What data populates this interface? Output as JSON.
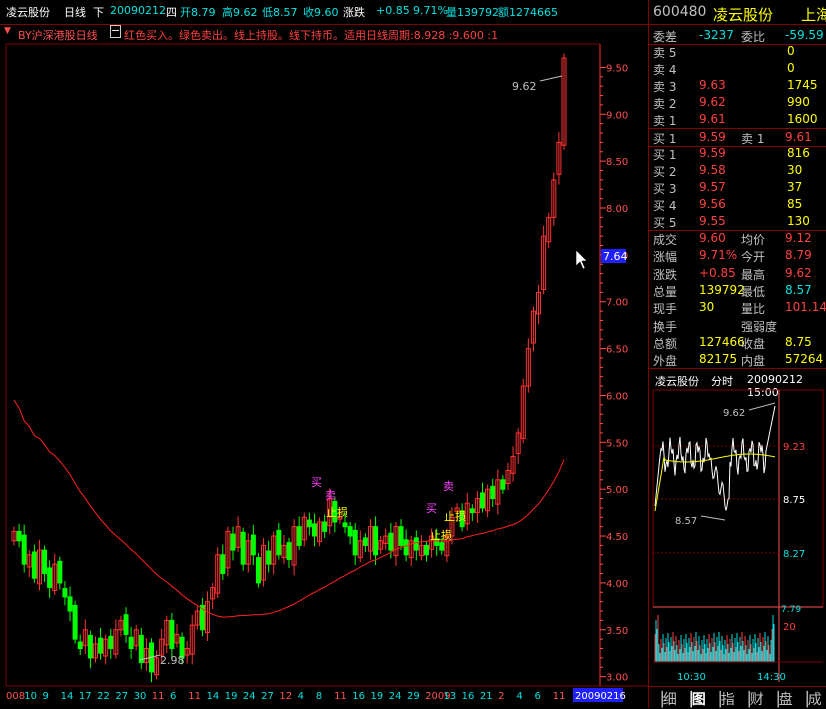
{
  "header": {
    "name": "凌云股份",
    "period": "日线",
    "dir": "下",
    "date": "20090212",
    "weekday": "四",
    "open": "开8.79",
    "high": "高9.62",
    "low": "低8.57",
    "close": "收9.60",
    "change_label": "涨跌",
    "change": "+0.85",
    "pct": "9.71%",
    "vol": "量139792",
    "amt": "额1274665"
  },
  "indicator": {
    "name": "BY沪深港股日线",
    "desc": "红色买入。绿色卖出。线上持股。线下持币。适用日线周期:8.928 :9.600 :1"
  },
  "price_axis": [
    "9.50",
    "9.00",
    "8.50",
    "8.00",
    "7.50",
    "7.00",
    "6.50",
    "6.00",
    "5.50",
    "5.00",
    "4.50",
    "4.00",
    "3.50",
    "3.00"
  ],
  "cursor_price": "7.64",
  "annotations": {
    "max": "9.62",
    "min": "2.98"
  },
  "signals": {
    "buy": "买",
    "sell": "卖",
    "stop": "止损"
  },
  "date_axis": [
    "008",
    "10",
    "9",
    "14",
    "17",
    "22",
    "27",
    "30",
    "11",
    "6",
    "11",
    "14",
    "19",
    "24",
    "27",
    "12",
    "4",
    "8",
    "11",
    "16",
    "19",
    "24",
    "29",
    "2009",
    "13",
    "16",
    "21",
    "2",
    "4",
    "6",
    "11"
  ],
  "date_axis_end": "20090216",
  "chart_data": {
    "type": "candlestick",
    "series": [
      {
        "name": "close",
        "values": [
          4.55,
          4.45,
          4.2,
          4.3,
          4.05,
          4.35,
          4.1,
          3.95,
          4.2,
          4.0,
          3.85,
          3.7,
          3.4,
          3.3,
          3.5,
          3.2,
          3.35,
          3.25,
          3.4,
          3.3,
          3.5,
          3.6,
          3.45,
          3.3,
          3.5,
          3.15,
          3.3,
          3.05,
          3.2,
          3.4,
          3.6,
          3.3,
          3.45,
          3.2,
          3.3,
          3.55,
          3.7,
          3.5,
          3.8,
          3.95,
          4.3,
          4.1,
          4.55,
          4.35,
          4.6,
          4.2,
          4.45,
          4.3,
          4.0,
          4.4,
          4.2,
          4.5,
          4.3,
          4.4,
          4.25,
          4.6,
          4.4,
          4.7,
          4.6,
          4.5,
          4.65,
          4.55,
          4.9,
          4.65,
          4.7,
          4.6,
          4.5,
          4.3,
          4.45,
          4.4,
          4.6,
          4.3,
          4.45,
          4.5,
          4.35,
          4.6,
          4.4,
          4.3,
          4.45,
          4.35,
          4.4,
          4.3,
          4.5,
          4.4,
          4.35,
          4.5,
          4.7,
          4.8,
          4.6,
          4.85,
          4.75,
          4.9,
          4.8,
          5.0,
          4.9,
          5.1,
          5.0,
          5.2,
          5.35,
          5.6,
          6.1,
          6.5,
          6.9,
          7.1,
          7.7,
          7.9,
          8.3,
          8.7,
          9.6
        ]
      }
    ],
    "ylim": [
      2.9,
      9.75
    ],
    "max": 9.62,
    "min": 2.98
  },
  "quote": {
    "code": "600480",
    "name": "凌云股份",
    "market": "上海",
    "weicha": "-3237",
    "weibi": "-59.59",
    "asks": [
      {
        "label": "卖 5",
        "price": "",
        "vol": "0"
      },
      {
        "label": "卖 4",
        "price": "",
        "vol": "0"
      },
      {
        "label": "卖 3",
        "price": "9.63",
        "vol": "1745"
      },
      {
        "label": "卖 2",
        "price": "9.62",
        "vol": "990"
      },
      {
        "label": "卖 1",
        "price": "9.61",
        "vol": "1600"
      }
    ],
    "mid": {
      "b1": "买 1",
      "p1": "9.59",
      "s1": "卖 1",
      "p2": "9.61"
    },
    "bids": [
      {
        "label": "买 1",
        "price": "9.59",
        "vol": "816"
      },
      {
        "label": "买 2",
        "price": "9.58",
        "vol": "30"
      },
      {
        "label": "买 3",
        "price": "9.57",
        "vol": "37"
      },
      {
        "label": "买 4",
        "price": "9.56",
        "vol": "85"
      },
      {
        "label": "买 5",
        "price": "9.55",
        "vol": "130"
      }
    ],
    "stats": [
      [
        "成交",
        "9.60",
        "均价",
        "9.12"
      ],
      [
        "涨幅",
        "9.71%",
        "今开",
        "8.79"
      ],
      [
        "涨跌",
        "+0.85",
        "最高",
        "9.62"
      ],
      [
        "总量",
        "139792",
        "最低",
        "8.57"
      ],
      [
        "现手",
        "30",
        "量比",
        "101.14"
      ],
      [
        "换手",
        "",
        "强弱度",
        ""
      ],
      [
        "总额",
        "127466",
        "收盘",
        "8.75"
      ],
      [
        "外盘",
        "82175",
        "内盘",
        "57264"
      ]
    ],
    "weicha_label": "委差",
    "weibi_label": "委比"
  },
  "mini": {
    "name": "凌云股份",
    "type": "分时",
    "datetime": "20090212 15:00",
    "prices": [
      "9.23",
      "8.75",
      "8.27"
    ],
    "hi": "9.62",
    "lo": "8.57",
    "vol_max": "20",
    "vol_top": "7.79",
    "times": [
      "10:30",
      "14:30"
    ]
  },
  "tabs": [
    "细",
    "图",
    "指",
    "财",
    "盘",
    "成"
  ],
  "colors": {
    "up": "#ff3232",
    "down": "#00ff00",
    "grid": "#800000",
    "axis": "#ff5050",
    "yellow": "#ffff00",
    "cyan": "#00e0e0",
    "magenta": "#ff40ff",
    "blue": "#2020ff"
  }
}
